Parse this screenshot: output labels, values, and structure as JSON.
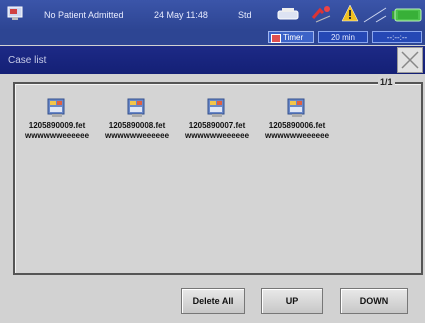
{
  "status": {
    "patient": "No Patient Admitted",
    "datetime": "24 May 11:48",
    "mode": "Std"
  },
  "timer": {
    "label": "Timer",
    "value": "20 min",
    "extra": "--:--:--"
  },
  "window": {
    "title": "Case list",
    "page": "1/1"
  },
  "files": [
    {
      "name": "1205890009.fet",
      "sub": "wwwwwweeeeee"
    },
    {
      "name": "1205890008.fet",
      "sub": "wwwwwweeeeee"
    },
    {
      "name": "1205890007.fet",
      "sub": "wwwwwweeeeee"
    },
    {
      "name": "1205890006.fet",
      "sub": "wwwwwweeeeee"
    }
  ],
  "buttons": {
    "delete_all": "Delete All",
    "up": "UP",
    "down": "DOWN"
  },
  "colors": {
    "statusbar": "#3b55a9",
    "titlebar": "#1d2a86",
    "background": "#d2d2d2"
  }
}
